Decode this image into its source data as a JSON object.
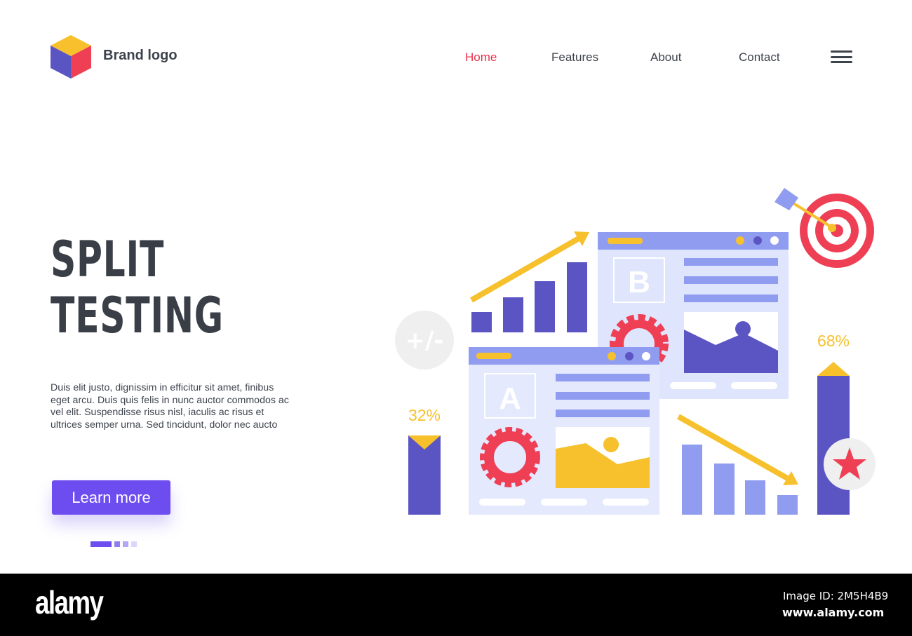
{
  "header": {
    "brand": "Brand logo",
    "nav": [
      {
        "label": "Home",
        "active": true
      },
      {
        "label": "Features"
      },
      {
        "label": "About"
      },
      {
        "label": "Contact"
      }
    ],
    "menu_icon": "hamburger-icon"
  },
  "hero": {
    "title_line1": "SPLIT",
    "title_line2": "TESTING",
    "description": "Duis elit justo, dignissim in efficitur sit amet, finibus eget arcu. Duis quis felis in nunc auctor commodos ac vel elit. Suspendisse risus nisl, iaculis ac risus et ultrices semper urna. Sed tincidunt, dolor nec aucto",
    "cta": "Learn more",
    "carousel_active": 1,
    "carousel_count": 4
  },
  "illustration": {
    "plus_minus": "+/-",
    "variant_a": "A",
    "variant_b": "B",
    "left_percent": "32%",
    "right_percent": "68%"
  },
  "footer": {
    "watermark": "alamy",
    "image_id": "Image ID: 2M5H4B9",
    "site": "www.alamy.com"
  },
  "colors": {
    "accent": "#6d4cf0",
    "active_nav": "#e8344e",
    "text": "#3d434c",
    "yellow": "#f6c12c",
    "indigo": "#5b55c4",
    "red": "#ee3f55"
  }
}
